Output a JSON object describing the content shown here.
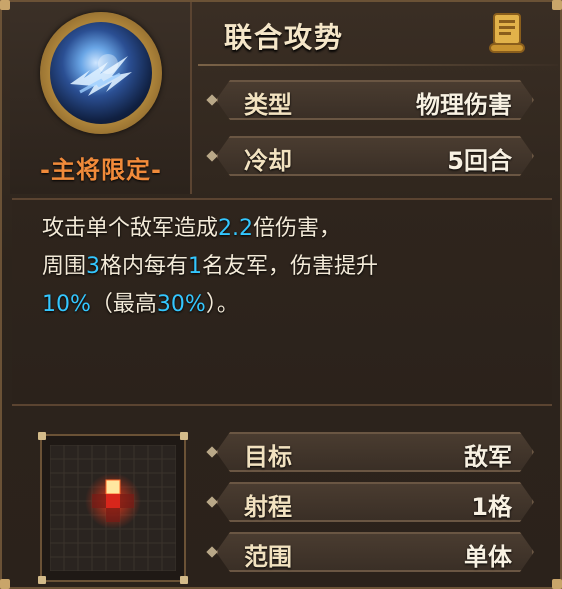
{
  "header": {
    "title": "联合攻势",
    "restriction": "-主将限定-",
    "icons": {
      "skill": "lightning-orb-icon",
      "info": "scroll-book-icon"
    }
  },
  "stats_top": [
    {
      "label": "类型",
      "value": "物理伤害"
    },
    {
      "label": "冷却",
      "value": "5回合"
    }
  ],
  "description": {
    "line1": {
      "a": "攻击单个敌军造成",
      "b": "2.2",
      "c": "倍伤害，"
    },
    "line2": {
      "a": "周围",
      "b": "3",
      "c": "格内每有",
      "d": "1",
      "e": "名友军，伤害提升"
    },
    "line3": {
      "a": "10%",
      "b": "（最高",
      "c": "30%",
      "d": "）。"
    }
  },
  "range_grid": {
    "rows": 9,
    "cols": 9,
    "icon": "range-grid-icon"
  },
  "stats_bottom": [
    {
      "label": "目标",
      "value": "敌军"
    },
    {
      "label": "射程",
      "value": "1格"
    },
    {
      "label": "范围",
      "value": "单体"
    }
  ],
  "colors": {
    "highlight": "#34c7ff",
    "restriction": "#f08a3a",
    "text": "#f3ead8"
  }
}
